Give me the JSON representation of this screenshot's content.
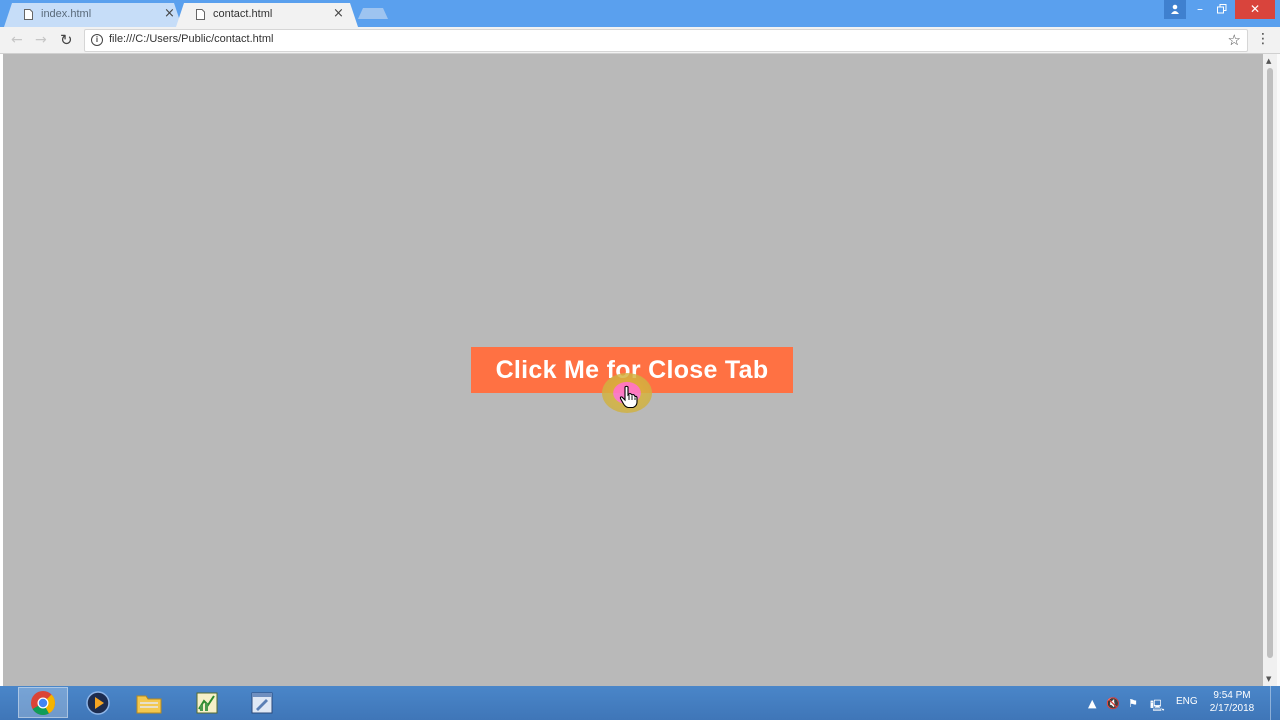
{
  "browser": {
    "tabs": [
      {
        "title": "index.html",
        "active": false
      },
      {
        "title": "contact.html",
        "active": true
      }
    ],
    "address_bar": {
      "url": "file:///C:/Users/Public/contact.html"
    },
    "icons": {
      "back": "arrow-left-icon",
      "forward": "arrow-right-icon",
      "reload": "reload-icon",
      "info": "info-icon",
      "bookmark": "star-icon",
      "menu": "vertical-dots-icon"
    }
  },
  "page": {
    "background": "#b9b9b9",
    "button_label": "Click Me for Close Tab",
    "button_color": "#ff7143"
  },
  "taskbar": {
    "apps": [
      "chrome-icon",
      "media-player-icon",
      "file-explorer-icon",
      "editor-icon",
      "notepad-plus-icon"
    ],
    "language": "ENG",
    "time": "9:54 PM",
    "date": "2/17/2018"
  },
  "colors": {
    "titlebar": "#5aa0ee",
    "close_button": "#d9443c",
    "taskbar": "#3f76b8"
  }
}
